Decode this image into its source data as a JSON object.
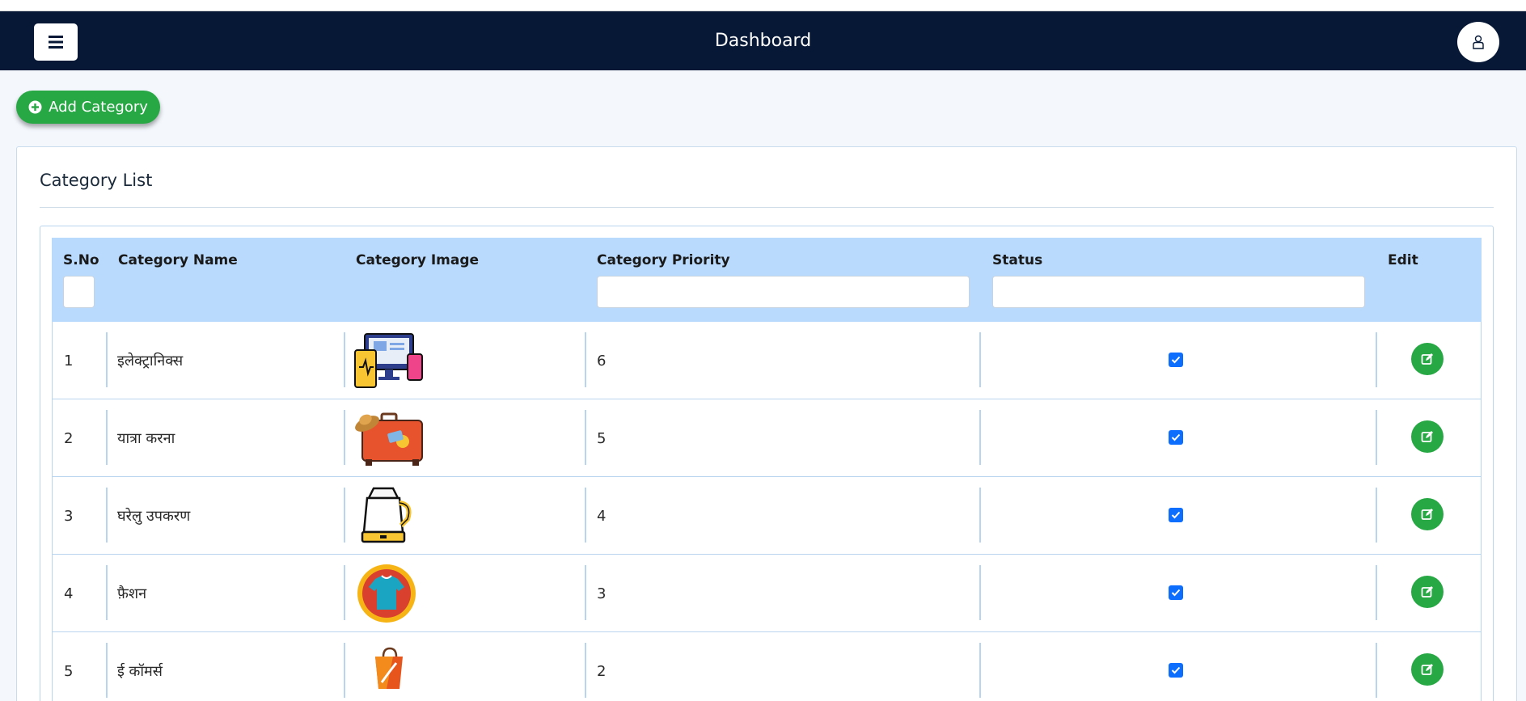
{
  "navbar": {
    "title": "Dashboard",
    "menu_icon": "hamburger-icon",
    "user_icon": "user-icon",
    "bg_color": "#061836"
  },
  "toolbar": {
    "add_label": "Add Category",
    "add_icon": "plus-circle-icon",
    "accent_color": "#27a844"
  },
  "card": {
    "title": "Category List"
  },
  "table": {
    "columns": [
      "S.No",
      "Category Name",
      "Category Image",
      "Category Priority",
      "Status",
      "Edit"
    ],
    "header_color": "#b9dafc",
    "rows": [
      {
        "sno": "1",
        "name": "इलेक्ट्रानिक्स",
        "image": "electronics-image",
        "priority": "6",
        "status_checked": true
      },
      {
        "sno": "2",
        "name": "यात्रा करना",
        "image": "travel-suitcase-image",
        "priority": "5",
        "status_checked": true
      },
      {
        "sno": "3",
        "name": "घरेलु उपकरण",
        "image": "kettle-image",
        "priority": "4",
        "status_checked": true
      },
      {
        "sno": "4",
        "name": "फ़ैशन",
        "image": "tshirt-image",
        "priority": "3",
        "status_checked": true
      },
      {
        "sno": "5",
        "name": "ई कॉमर्स",
        "image": "shopping-bag-image",
        "priority": "2",
        "status_checked": true
      }
    ]
  }
}
